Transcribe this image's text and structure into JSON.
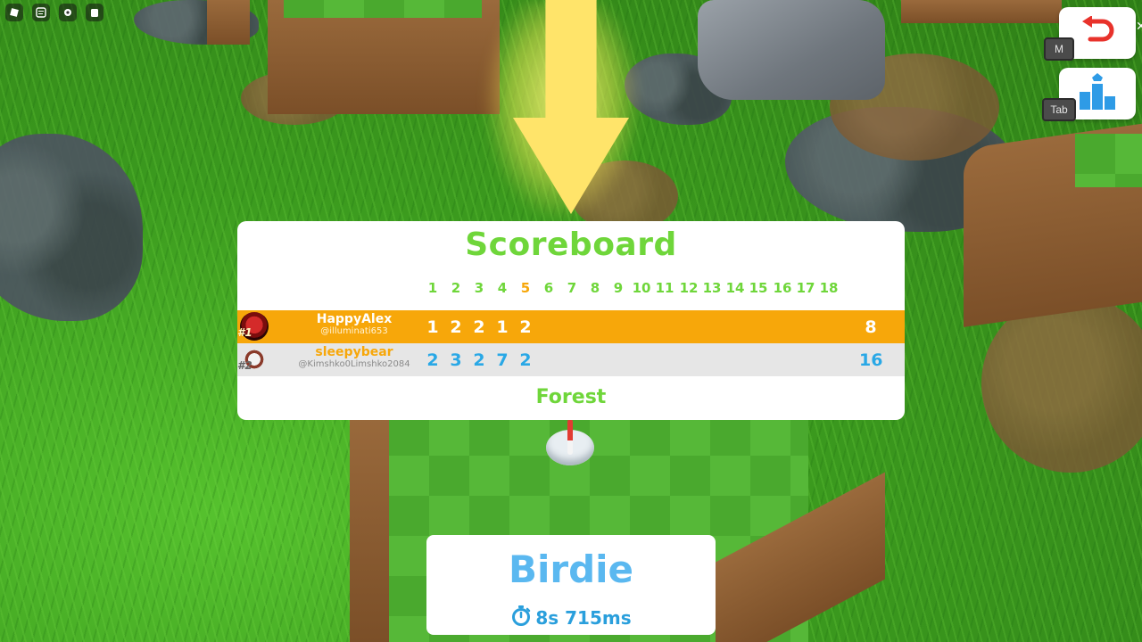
{
  "scoreboard": {
    "title": "Scoreboard",
    "holes": [
      "1",
      "2",
      "3",
      "4",
      "5",
      "6",
      "7",
      "8",
      "9",
      "10",
      "11",
      "12",
      "13",
      "14",
      "15",
      "16",
      "17",
      "18"
    ],
    "current_hole_index": 4,
    "players": [
      {
        "rank": "#1",
        "name": "HappyAlex",
        "username": "@illuminati653",
        "scores": [
          "1",
          "2",
          "2",
          "1",
          "2"
        ],
        "total": "8"
      },
      {
        "rank": "#2",
        "name": "sleepybear",
        "username": "@Kimshko0Limshko2084",
        "scores": [
          "2",
          "3",
          "2",
          "7",
          "2"
        ],
        "total": "16"
      }
    ],
    "course": "Forest"
  },
  "result": {
    "title": "Birdie",
    "time": "8s 715ms",
    "timer_icon": "stopwatch-icon"
  },
  "controls": {
    "reset_key": "M",
    "leaderboard_key": "Tab",
    "reset_icon": "undo-icon",
    "leaderboard_icon": "podium-icon"
  },
  "topbar": {
    "icons": [
      "roblox-menu-icon",
      "chat-icon",
      "settings-icon",
      "backpack-icon"
    ]
  },
  "colors": {
    "title_green": "#6fd63a",
    "first_row": "#f7a70a",
    "second_row": "#e6e6e6",
    "score_blue": "#29a8e6",
    "current_hole": "#f7a70a",
    "reset_red": "#e8322b",
    "podium_blue": "#2e9be6"
  }
}
